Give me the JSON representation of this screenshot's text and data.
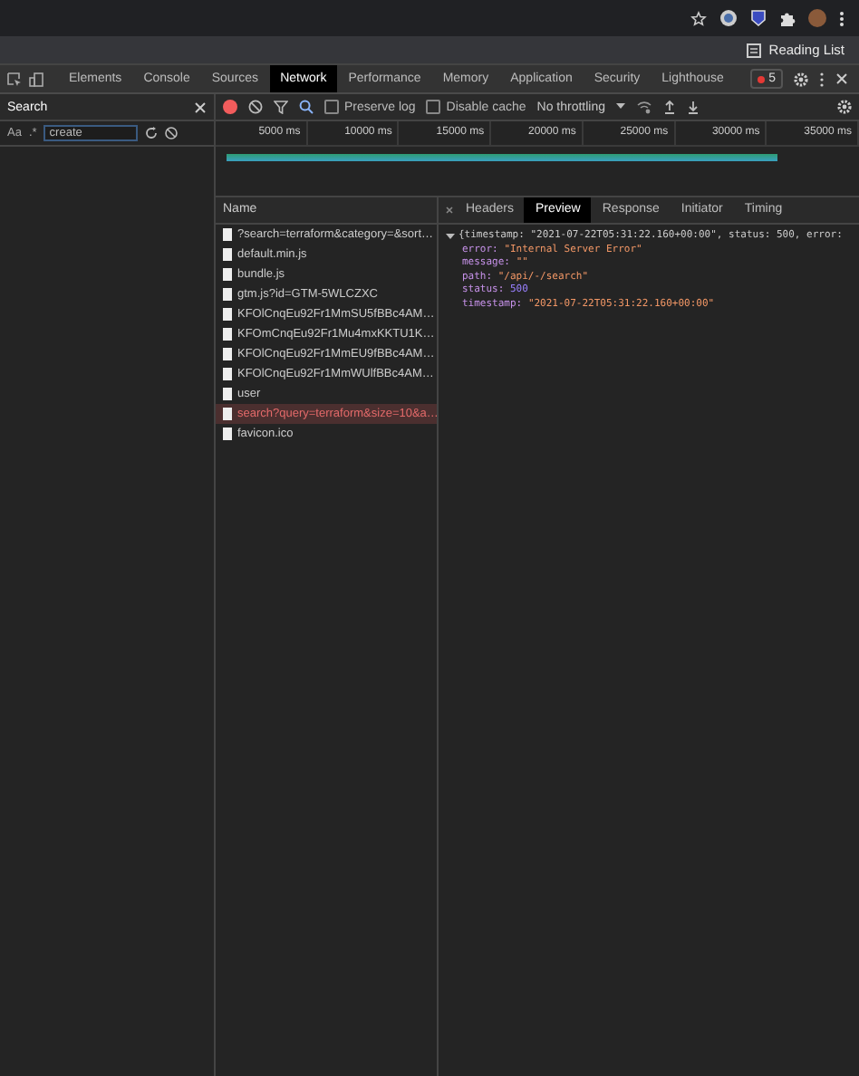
{
  "browser": {
    "reading_list": "Reading List"
  },
  "devtools_tabs": [
    {
      "label": "Elements",
      "selected": false
    },
    {
      "label": "Console",
      "selected": false
    },
    {
      "label": "Sources",
      "selected": false
    },
    {
      "label": "Network",
      "selected": true
    },
    {
      "label": "Performance",
      "selected": false
    },
    {
      "label": "Memory",
      "selected": false
    },
    {
      "label": "Application",
      "selected": false
    },
    {
      "label": "Security",
      "selected": false
    },
    {
      "label": "Lighthouse",
      "selected": false
    }
  ],
  "error_badge": "5",
  "search_panel": {
    "title": "Search",
    "match_case": "Aa",
    "regex": ".*",
    "query": "create"
  },
  "network_toolbar": {
    "recording": true,
    "preserve_log": {
      "label": "Preserve log",
      "checked": false
    },
    "disable_cache": {
      "label": "Disable cache",
      "checked": false
    },
    "throttling": "No throttling"
  },
  "timeline": {
    "ticks": [
      "5000 ms",
      "10000 ms",
      "15000 ms",
      "20000 ms",
      "25000 ms",
      "30000 ms",
      "35000 ms"
    ],
    "level": 0.88
  },
  "requests": {
    "column": "Name",
    "rows": [
      {
        "name": "?search=terraform&category=&sort…",
        "error": false,
        "selected": false
      },
      {
        "name": "default.min.js",
        "error": false,
        "selected": false
      },
      {
        "name": "bundle.js",
        "error": false,
        "selected": false
      },
      {
        "name": "gtm.js?id=GTM-5WLCZXC",
        "error": false,
        "selected": false
      },
      {
        "name": "KFOlCnqEu92Fr1MmSU5fBBc4AM…",
        "error": false,
        "selected": false
      },
      {
        "name": "KFOmCnqEu92Fr1Mu4mxKKTU1K…",
        "error": false,
        "selected": false
      },
      {
        "name": "KFOlCnqEu92Fr1MmEU9fBBc4AM…",
        "error": false,
        "selected": false
      },
      {
        "name": "KFOlCnqEu92Fr1MmWUlfBBc4AM…",
        "error": false,
        "selected": false
      },
      {
        "name": "user",
        "error": false,
        "selected": false
      },
      {
        "name": "search?query=terraform&size=10&a…",
        "error": true,
        "selected": true
      },
      {
        "name": "favicon.ico",
        "error": false,
        "selected": false
      }
    ]
  },
  "detail_tabs": [
    {
      "label": "Headers",
      "selected": false
    },
    {
      "label": "Preview",
      "selected": true
    },
    {
      "label": "Response",
      "selected": false
    },
    {
      "label": "Initiator",
      "selected": false
    },
    {
      "label": "Timing",
      "selected": false
    }
  ],
  "preview": {
    "summary": "{timestamp: \"2021-07-22T05:31:22.160+00:00\", status: 500, error:",
    "expanded": true,
    "properties": [
      {
        "key": "error:",
        "value": "\"Internal Server Error\"",
        "kind": "string"
      },
      {
        "key": "message:",
        "value": "\"\"",
        "kind": "string"
      },
      {
        "key": "path:",
        "value": "\"/api/-/search\"",
        "kind": "string"
      },
      {
        "key": "status:",
        "value": "500",
        "kind": "number"
      },
      {
        "key": "timestamp:",
        "value": "\"2021-07-22T05:31:22.160+00:00\"",
        "kind": "string"
      }
    ]
  }
}
